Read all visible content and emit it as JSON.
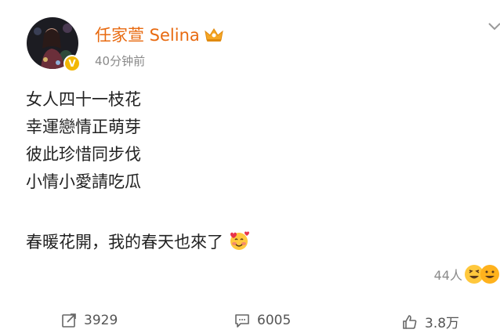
{
  "post": {
    "author": {
      "name": "任家萱 Selina",
      "verified": true,
      "badge_icon": "crown-icon"
    },
    "timestamp": "40分钟前",
    "content_lines": [
      "女人四十一枝花",
      "幸運戀情正萌芽",
      "彼此珍惜同步伐",
      "小情小愛請吃瓜"
    ],
    "closing_line": "春暖花開，我的春天也來了",
    "closing_emoji": "smiling-face-with-hearts-icon",
    "reactions": {
      "count": "44人"
    },
    "actions": {
      "repost_count": "3929",
      "comment_count": "6005",
      "like_count": "3.8万"
    }
  },
  "colors": {
    "username": "#e86a10",
    "verified_badge": "#f2b705",
    "muted_text": "#8a8a8a"
  }
}
